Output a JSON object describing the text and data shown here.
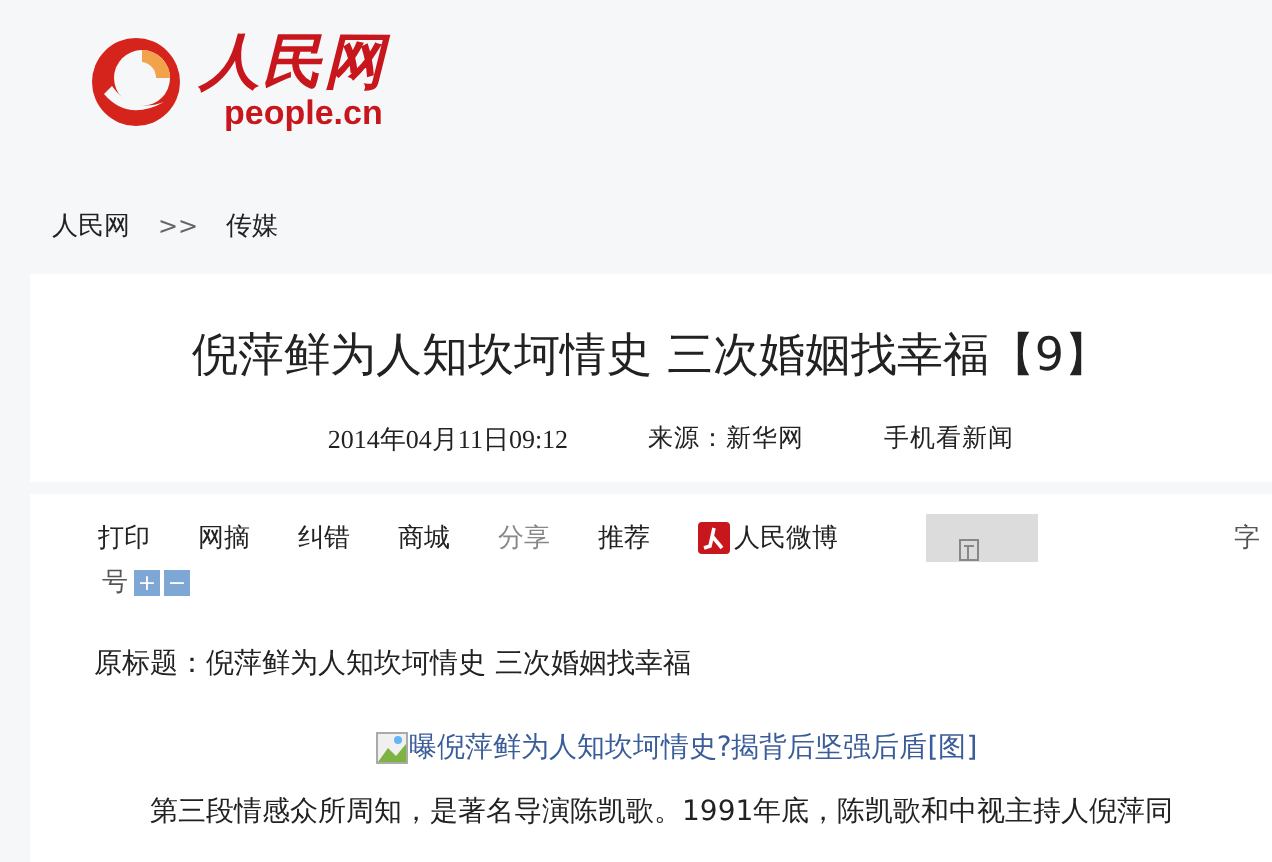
{
  "header": {
    "logo_name": "人民网",
    "logo_domain": "people.cn"
  },
  "breadcrumb": [
    {
      "label": "人民网",
      "kind": "link"
    },
    {
      "label": ">>",
      "kind": "separator"
    },
    {
      "label": "传媒",
      "kind": "link"
    }
  ],
  "article": {
    "title": "倪萍鲜为人知坎坷情史 三次婚姻找幸福【9】",
    "meta": [
      {
        "text": "2014年04月11日09:12",
        "kind": "date"
      },
      {
        "text": "来源：新华网",
        "kind": "source"
      },
      {
        "text": "手机看新闻",
        "kind": "link"
      }
    ],
    "toolbar": [
      {
        "label": "打印",
        "kind": "link"
      },
      {
        "label": "网摘",
        "kind": "link"
      },
      {
        "label": "纠错",
        "kind": "link"
      },
      {
        "label": "商城",
        "kind": "link"
      },
      {
        "label": "分享",
        "kind": "muted"
      },
      {
        "label": "推荐",
        "kind": "link"
      },
      {
        "label": "人民微博",
        "kind": "weibo"
      }
    ],
    "font_size": {
      "label_start": "字",
      "label_end": "号",
      "buttons": [
        "+",
        "−"
      ]
    },
    "original_title": "原标题：倪萍鲜为人知坎坷情史 三次婚姻找幸福",
    "image_alt": "曝倪萍鲜为人知坎坷情史?揭背后坚强后盾[图]",
    "paragraph": "第三段情感众所周知，是著名导演陈凯歌。1991年底，陈凯歌和中视主持人倪萍同"
  }
}
